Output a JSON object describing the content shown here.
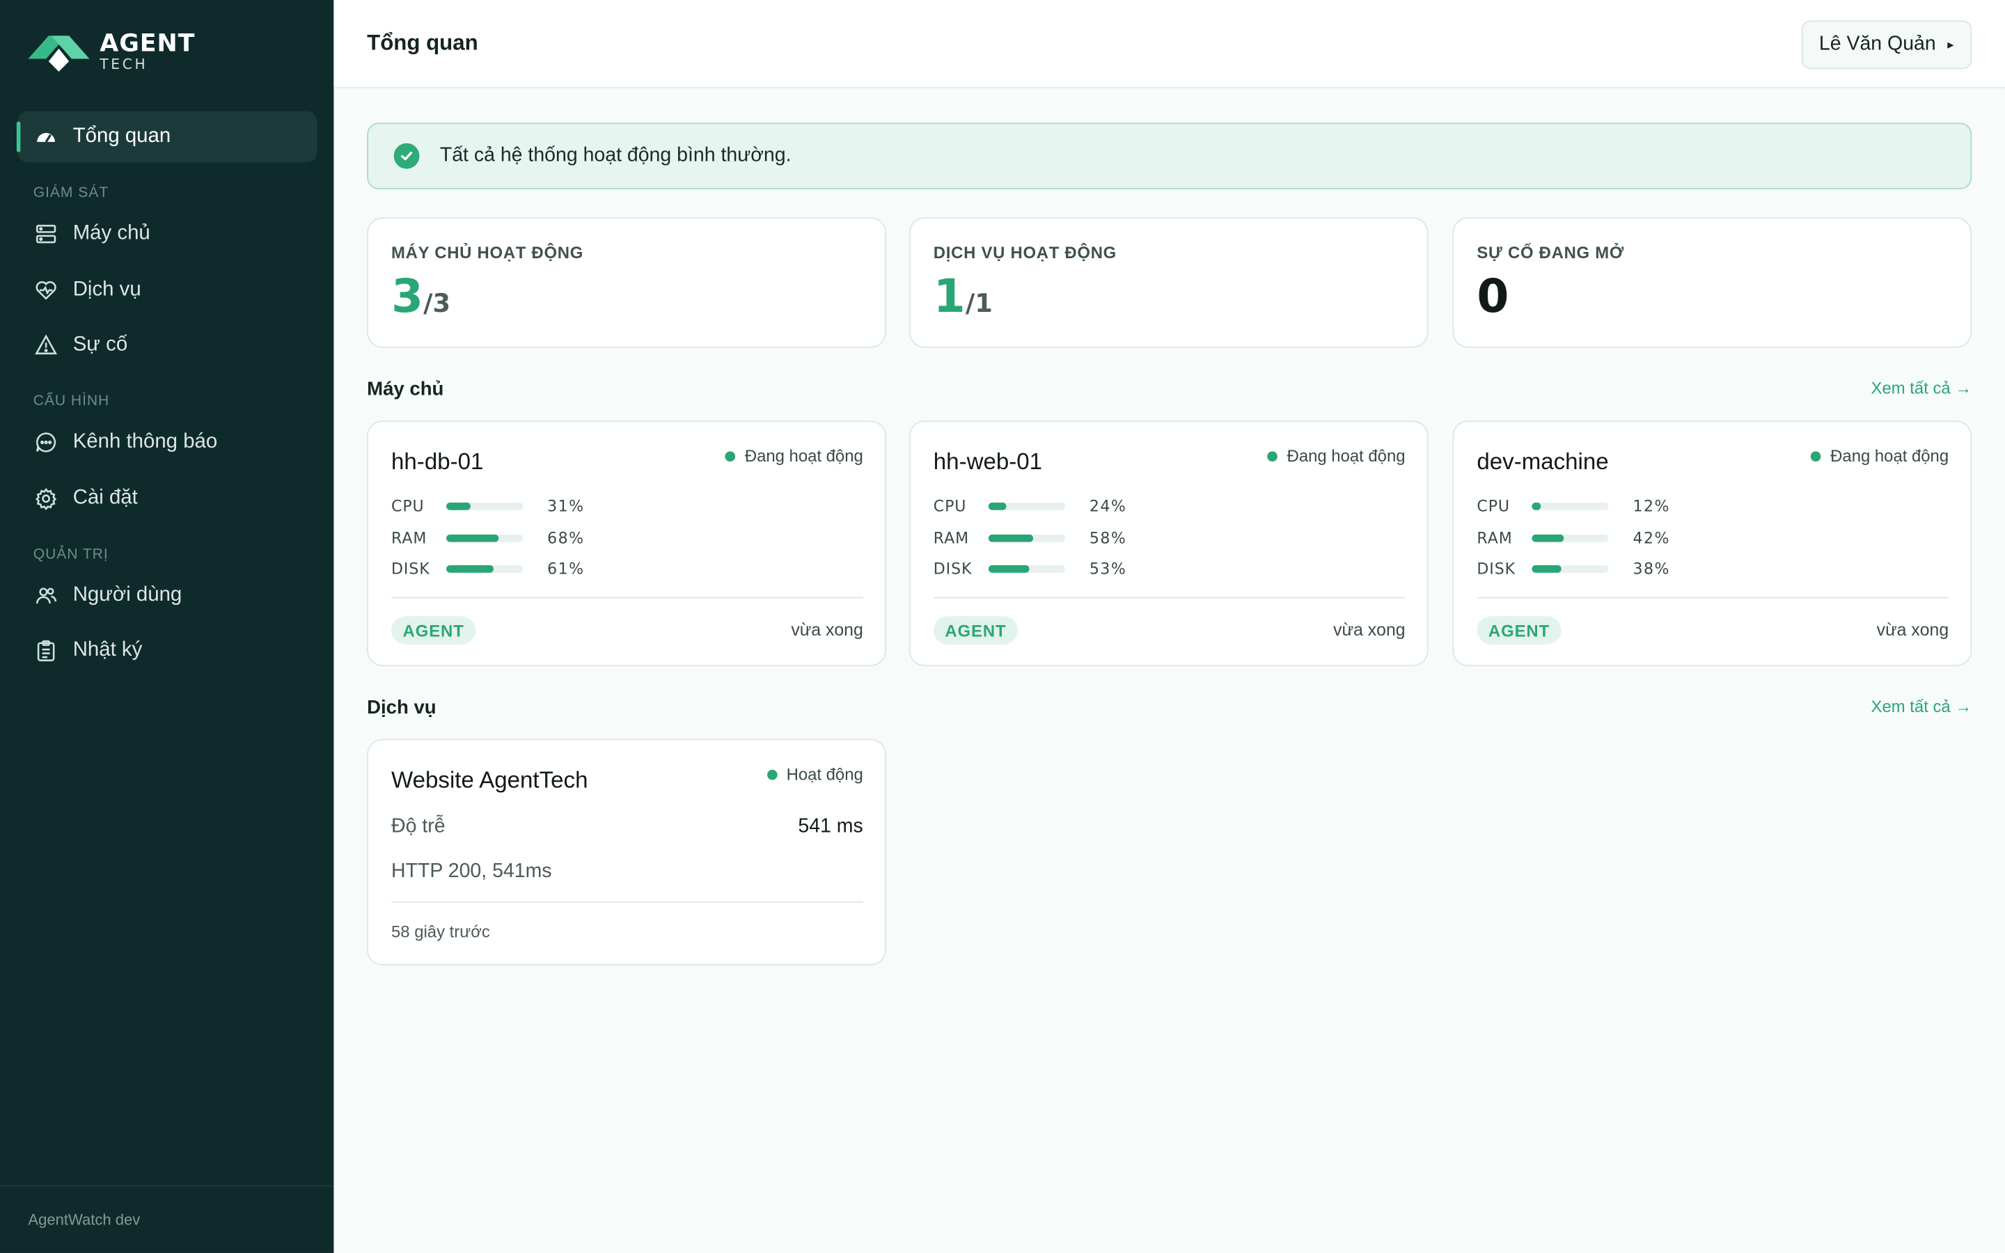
{
  "sidebar": {
    "logo_line1": "AGENT",
    "logo_line2": "TECH",
    "nav_overview": "Tổng quan",
    "section_monitor": "GIÁM SÁT",
    "nav_servers": "Máy chủ",
    "nav_services": "Dịch vụ",
    "nav_incidents": "Sự cố",
    "section_config": "CẤU HÌNH",
    "nav_channels": "Kênh thông báo",
    "nav_settings": "Cài đặt",
    "section_admin": "QUẢN TRỊ",
    "nav_users": "Người dùng",
    "nav_logs": "Nhật ký",
    "footer": "AgentWatch dev"
  },
  "header": {
    "title": "Tổng quan",
    "user": "Lê Văn Quản",
    "user_caret": "▸"
  },
  "alert": {
    "text": "Tất cả hệ thống hoạt động bình thường."
  },
  "stats": {
    "servers": {
      "label": "MÁY CHỦ HOẠT ĐỘNG",
      "value": "3",
      "total": "/3"
    },
    "services": {
      "label": "DỊCH VỤ HOẠT ĐỘNG",
      "value": "1",
      "total": "/1"
    },
    "incidents": {
      "label": "SỰ CỐ ĐANG MỞ",
      "value": "0"
    }
  },
  "servers_section": {
    "title": "Máy chủ",
    "see_all": "Xem tất cả →"
  },
  "servers": [
    {
      "name": "hh-db-01",
      "status": "Đang hoạt động",
      "cpu_label": "CPU",
      "cpu": "31%",
      "cpu_pct": 31,
      "ram_label": "RAM",
      "ram": "68%",
      "ram_pct": 68,
      "disk_label": "DISK",
      "disk": "61%",
      "disk_pct": 61,
      "badge": "AGENT",
      "updated": "vừa xong"
    },
    {
      "name": "hh-web-01",
      "status": "Đang hoạt động",
      "cpu_label": "CPU",
      "cpu": "24%",
      "cpu_pct": 24,
      "ram_label": "RAM",
      "ram": "58%",
      "ram_pct": 58,
      "disk_label": "DISK",
      "disk": "53%",
      "disk_pct": 53,
      "badge": "AGENT",
      "updated": "vừa xong"
    },
    {
      "name": "dev-machine",
      "status": "Đang hoạt động",
      "cpu_label": "CPU",
      "cpu": "12%",
      "cpu_pct": 12,
      "ram_label": "RAM",
      "ram": "42%",
      "ram_pct": 42,
      "disk_label": "DISK",
      "disk": "38%",
      "disk_pct": 38,
      "badge": "AGENT",
      "updated": "vừa xong"
    }
  ],
  "services_section": {
    "title": "Dịch vụ",
    "see_all": "Xem tất cả →"
  },
  "service": {
    "name": "Website AgentTech",
    "status": "Hoạt động",
    "latency_label": "Độ trễ",
    "latency": "541 ms",
    "detail": "HTTP 200, 541ms",
    "time": "58 giây trước"
  },
  "colors": {
    "accent": "#2aa676",
    "sidebar_bg": "#0f2a2b"
  }
}
